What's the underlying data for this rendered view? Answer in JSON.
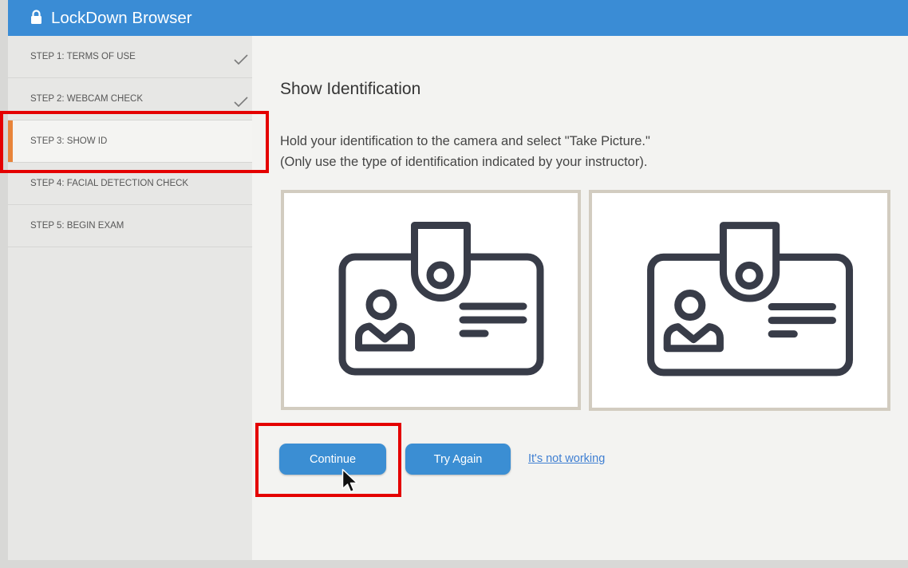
{
  "app": {
    "title": "LockDown Browser"
  },
  "icons": {
    "header": "lock-icon",
    "step_done": "check-icon",
    "preview": "id-card-icon",
    "pointer": "cursor-arrow-icon"
  },
  "colors": {
    "header_bg": "#3a8cd5",
    "active_indicator": "#e8843a",
    "button_bg": "#3b8ed3",
    "link": "#3f7fd2",
    "highlight": "#e40000"
  },
  "steps": [
    {
      "label": "STEP 1: TERMS OF USE",
      "completed": true,
      "active": false
    },
    {
      "label": "STEP 2: WEBCAM CHECK",
      "completed": true,
      "active": false
    },
    {
      "label": "STEP 3: SHOW ID",
      "completed": false,
      "active": true
    },
    {
      "label": "STEP 4: FACIAL DETECTION CHECK",
      "completed": false,
      "active": false
    },
    {
      "label": "STEP 5: BEGIN EXAM",
      "completed": false,
      "active": false
    }
  ],
  "main": {
    "heading": "Show Identification",
    "instructions": [
      "Hold your identification to the camera and select \"Take Picture.\"",
      "(Only use the type of identification indicated by your instructor)."
    ]
  },
  "actions": {
    "continue_label": "Continue",
    "try_again_label": "Try Again",
    "not_working_link": "It's not working"
  }
}
